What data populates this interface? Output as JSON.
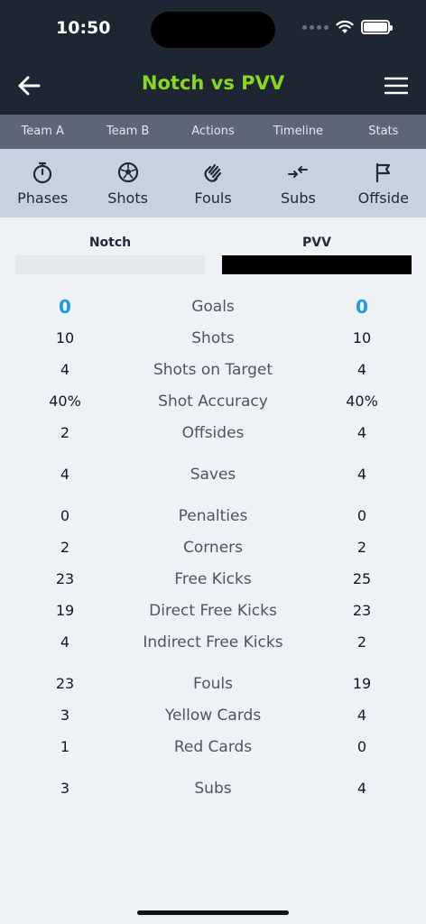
{
  "status": {
    "time": "10:50"
  },
  "header": {
    "title": "Notch vs PVV"
  },
  "tabs": [
    "Team A",
    "Team B",
    "Actions",
    "Timeline",
    "Stats"
  ],
  "iconbar": [
    {
      "label": "Phases",
      "icon": "stopwatch-icon"
    },
    {
      "label": "Shots",
      "icon": "soccer-ball-icon"
    },
    {
      "label": "Fouls",
      "icon": "hand-wave-icon"
    },
    {
      "label": "Subs",
      "icon": "swap-arrows-icon"
    },
    {
      "label": "Offside",
      "icon": "flag-icon"
    }
  ],
  "teams": {
    "a": "Notch",
    "b": "PVV",
    "a_color": "#e4e7ec",
    "b_color": "#000000"
  },
  "stats": [
    {
      "label": "Goals",
      "a": "0",
      "b": "0"
    },
    {
      "label": "Shots",
      "a": "10",
      "b": "10"
    },
    {
      "label": "Shots on Target",
      "a": "4",
      "b": "4"
    },
    {
      "label": "Shot Accuracy",
      "a": "40%",
      "b": "40%"
    },
    {
      "label": "Offsides",
      "a": "2",
      "b": "4"
    },
    {
      "label": "Saves",
      "a": "4",
      "b": "4"
    },
    {
      "label": "Penalties",
      "a": "0",
      "b": "0"
    },
    {
      "label": "Corners",
      "a": "2",
      "b": "2"
    },
    {
      "label": "Free Kicks",
      "a": "23",
      "b": "25"
    },
    {
      "label": "Direct Free Kicks",
      "a": "19",
      "b": "23"
    },
    {
      "label": "Indirect Free Kicks",
      "a": "4",
      "b": "2"
    },
    {
      "label": "Fouls",
      "a": "23",
      "b": "19"
    },
    {
      "label": "Yellow Cards",
      "a": "3",
      "b": "4"
    },
    {
      "label": "Red Cards",
      "a": "1",
      "b": "0"
    },
    {
      "label": "Subs",
      "a": "3",
      "b": "4"
    }
  ],
  "colors": {
    "accent": "#8ad81e",
    "goal": "#1f9bdc",
    "header_bg": "#1e2632"
  }
}
